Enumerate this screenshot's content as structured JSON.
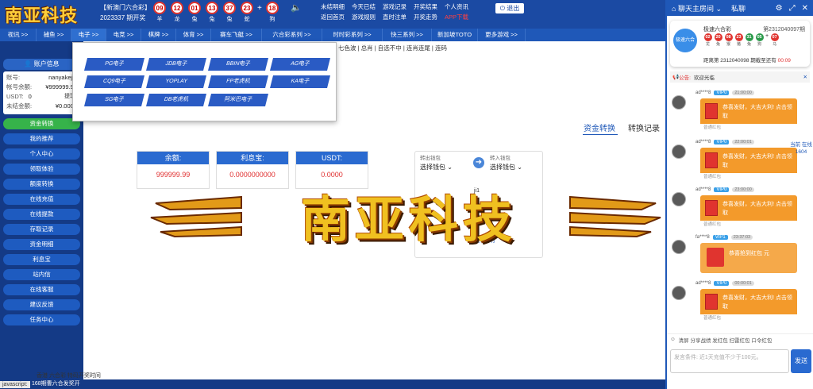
{
  "brand": {
    "logo": "南亚科技",
    "watermark": "南亚科技"
  },
  "lottery": {
    "line1": "【新澳门六合彩】",
    "line2": "2023337 期开奖",
    "balls": [
      {
        "num": "09",
        "zodiac": "羊"
      },
      {
        "num": "12",
        "zodiac": "龙"
      },
      {
        "num": "01",
        "zodiac": "兔"
      },
      {
        "num": "13",
        "zodiac": "兔"
      },
      {
        "num": "37",
        "zodiac": "兔"
      },
      {
        "num": "23",
        "zodiac": "蛇"
      },
      {
        "num": "18",
        "zodiac": "狗"
      }
    ]
  },
  "toplinks": [
    "未结明细",
    "今天已结",
    "游戏记录",
    "开奖结果",
    "个人资讯",
    "返回首页",
    "游戏规则",
    "直时注单",
    "开奖走势",
    "APP下载"
  ],
  "logout": "退出",
  "nav": [
    "视讯 >>",
    "捕鱼 >>",
    "电子 >>",
    "电竞 >>",
    "棋牌 >>",
    "体育 >>",
    "赛车飞艇 >>",
    "六合彩系列 >>",
    "时时彩系列 >>",
    "快三系列 >>",
    "新加坡TOTO",
    "更多游戏 >>"
  ],
  "subbar": "七色波 | 总肖 | 自选不中 | 连肖连尾 | 连码",
  "dropdown": [
    "PG电子",
    "JDB电子",
    "BBIN电子",
    "AG电子",
    "CQ9电子",
    "YOPLAY",
    "FP老虎机",
    "KA电子",
    "SG电子",
    "DB老虎机",
    "阿米巴电子"
  ],
  "account": {
    "title": "账户信息",
    "rows": [
      {
        "k": "账号:",
        "v": "nanyakeji1"
      },
      {
        "k": "帐号余额:",
        "v": "¥999999.99"
      },
      {
        "k": "USDT:",
        "v": "0"
      },
      {
        "k": "未结金额:",
        "v": "¥0.0000"
      }
    ],
    "withdraw": "提现"
  },
  "side_menu": [
    "资金转换",
    "我的推荐",
    "个人中心",
    "领取体验",
    "额度转换",
    "在线充值",
    "在线提款",
    "存取记录",
    "资金明细",
    "利息宝",
    "站内信",
    "在线客服",
    "建议反馈",
    "任务中心"
  ],
  "tabs": [
    "资金转换",
    "转换记录"
  ],
  "cards": [
    {
      "label": "余额:",
      "value": "999999.99"
    },
    {
      "label": "利息宝:",
      "value": "0.0000000000"
    },
    {
      "label": "USDT:",
      "value": "0.0000"
    }
  ],
  "transfer": {
    "out_label": "转出钱包",
    "out_value": "选择钱包",
    "in_label": "转入钱包",
    "in_value": "选择钱包",
    "user_hint": "ji1",
    "use_label": "使用说明"
  },
  "bottom": {
    "ticker": "香港 六合彩 特码开奖时间",
    "ticker2": "168期曹六合发奖开",
    "jslabel": "javascript:"
  },
  "chat": {
    "room": "聊天主房间",
    "private": "私聊",
    "lot_logo": "极速六合",
    "lot_name": "极速六合彩",
    "lot_issue": "第2312040097期",
    "lot_balls": [
      {
        "num": "02",
        "zodiac": "龙",
        "color": "#e0342f"
      },
      {
        "num": "20",
        "zodiac": "兔",
        "color": "#e0342f"
      },
      {
        "num": "08",
        "zodiac": "猴",
        "color": "#e0342f"
      },
      {
        "num": "23",
        "zodiac": "猪",
        "color": "#e0342f"
      },
      {
        "num": "31",
        "zodiac": "兔",
        "color": "#2a9a4a"
      },
      {
        "num": "05",
        "zodiac": "狗",
        "color": "#2a9a4a"
      },
      {
        "num": "07",
        "zodiac": "马",
        "color": "#e0342f"
      }
    ],
    "lot_next": "距离第 2312040098 期截至还有",
    "lot_countdown": "00:09",
    "notice_label": "公告:",
    "notice_text": "欢迎光临",
    "messages": [
      {
        "user": "ad****8",
        "vip": "VIP0",
        "time": "21:00:00",
        "text": "恭喜发财，大吉大利! 点击领取",
        "foot": "普通红包"
      },
      {
        "user": "ad****8",
        "vip": "VIP0",
        "time": "22:00:01",
        "text": "恭喜发财，大吉大利! 点击领取",
        "foot": "普通红包"
      },
      {
        "user": "ad****8",
        "vip": "VIP0",
        "time": "23:00:00",
        "text": "恭喜发财，大吉大利! 点击领取",
        "foot": "普通红包"
      },
      {
        "user": "fa****8",
        "vip": "VIP1",
        "time": "23:37:03",
        "text": "恭喜抢到红包 元",
        "foot": ""
      },
      {
        "user": "ad****8",
        "vip": "VIP0",
        "time": "00:00:01",
        "text": "恭喜发财，大吉大利! 点击领取",
        "foot": "普通红包"
      }
    ],
    "side_ad": "当前 在线 1604",
    "tools": "清屏 分享战绩 发红包 扫雷红包 口令红包",
    "input_placeholder": "发言条件: 近1天充值不少于100元。",
    "send": "发送"
  }
}
